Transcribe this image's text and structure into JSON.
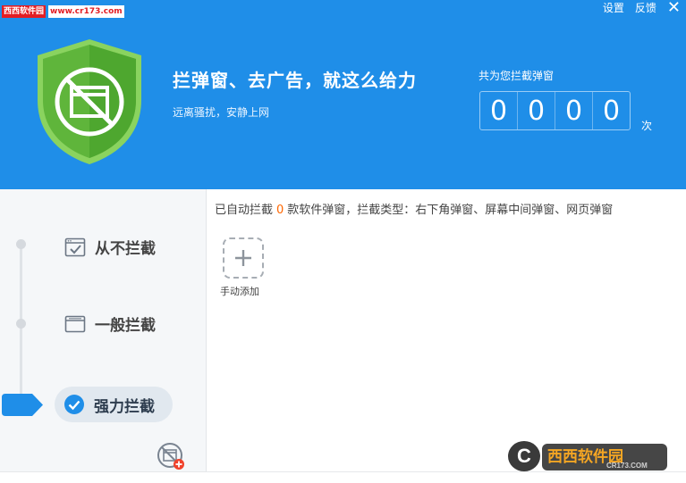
{
  "watermark": {
    "brand": "西西软件园",
    "url": "www.cr173.com",
    "bottom_brand": "西西软件园",
    "bottom_url": "CR173.COM"
  },
  "toolbar": {
    "settings_label": "设置",
    "feedback_label": "反馈",
    "close_label": "✕"
  },
  "header": {
    "title": "拦弹窗、去广告，就这么给力",
    "subtitle": "远离骚扰，安静上网",
    "counter_label": "共为您拦截弹窗",
    "digits": [
      "0",
      "0",
      "0",
      "0"
    ],
    "counter_unit": "次"
  },
  "levels": [
    {
      "label": "从不拦截",
      "icon": "checked-window-icon",
      "selected": false
    },
    {
      "label": "一般拦截",
      "icon": "window-icon",
      "selected": false
    },
    {
      "label": "强力拦截",
      "icon": "check-circle-icon",
      "selected": true
    }
  ],
  "main": {
    "status_prefix": "已自动拦截",
    "status_count": "0",
    "status_suffix": "款软件弹窗，拦截类型：右下角弹窗、屏幕中间弹窗、网页弹窗",
    "add_label": "手动添加"
  },
  "colors": {
    "header_blue": "#1f8ee8",
    "shield_green": "#5fb53b",
    "accent_orange": "#ff6600",
    "selected_blue": "#1f8ee8"
  }
}
